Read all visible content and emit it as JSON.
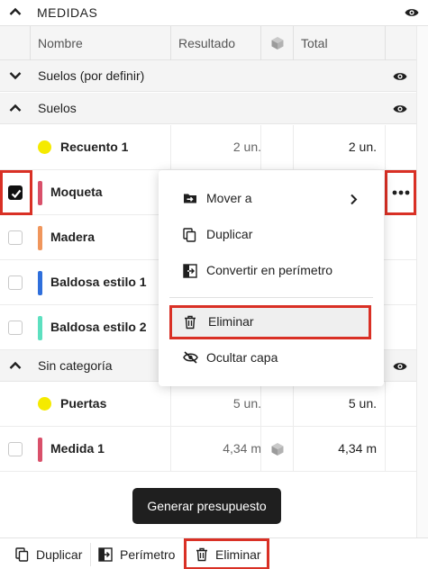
{
  "panel": {
    "title": "MEDIDAS"
  },
  "columns": {
    "name": "Nombre",
    "result": "Resultado",
    "total": "Total"
  },
  "groups": {
    "suelos_por_definir": "Suelos (por definir)",
    "suelos": "Suelos",
    "sin_categoria": "Sin categoría"
  },
  "rows": [
    {
      "name": "Recuento 1",
      "result": "2 un.",
      "total": "2 un.",
      "color": "#f5ea00",
      "marker": "dot",
      "checked": false
    },
    {
      "name": "Moqueta",
      "result": "",
      "total": "",
      "color": "#d9506a",
      "marker": "bar",
      "checked": true
    },
    {
      "name": "Madera",
      "result": "",
      "total": "",
      "color": "#f0965c",
      "marker": "bar",
      "checked": false
    },
    {
      "name": "Baldosa estilo 1",
      "result": "",
      "total": "",
      "color": "#2f6fdc",
      "marker": "bar",
      "checked": false
    },
    {
      "name": "Baldosa estilo 2",
      "result": "",
      "total": "",
      "color": "#5de0c0",
      "marker": "bar",
      "checked": false
    },
    {
      "name": "Puertas",
      "result": "5 un.",
      "total": "5 un.",
      "color": "#f5ea00",
      "marker": "dot",
      "checked": false
    },
    {
      "name": "Medida 1",
      "result": "4,34 m",
      "total": "4,34 m",
      "color": "#d9506a",
      "marker": "bar",
      "checked": false
    }
  ],
  "context_menu": {
    "move_to": "Mover a",
    "duplicate": "Duplicar",
    "convert": "Convertir en perímetro",
    "delete": "Eliminar",
    "hide_layer": "Ocultar capa"
  },
  "actions": {
    "generate_budget": "Generar presupuesto"
  },
  "footer": {
    "duplicate": "Duplicar",
    "perimeter": "Perímetro",
    "delete": "Eliminar"
  },
  "colors": {
    "accent_red": "#d93025",
    "dark": "#1f1f1f"
  }
}
